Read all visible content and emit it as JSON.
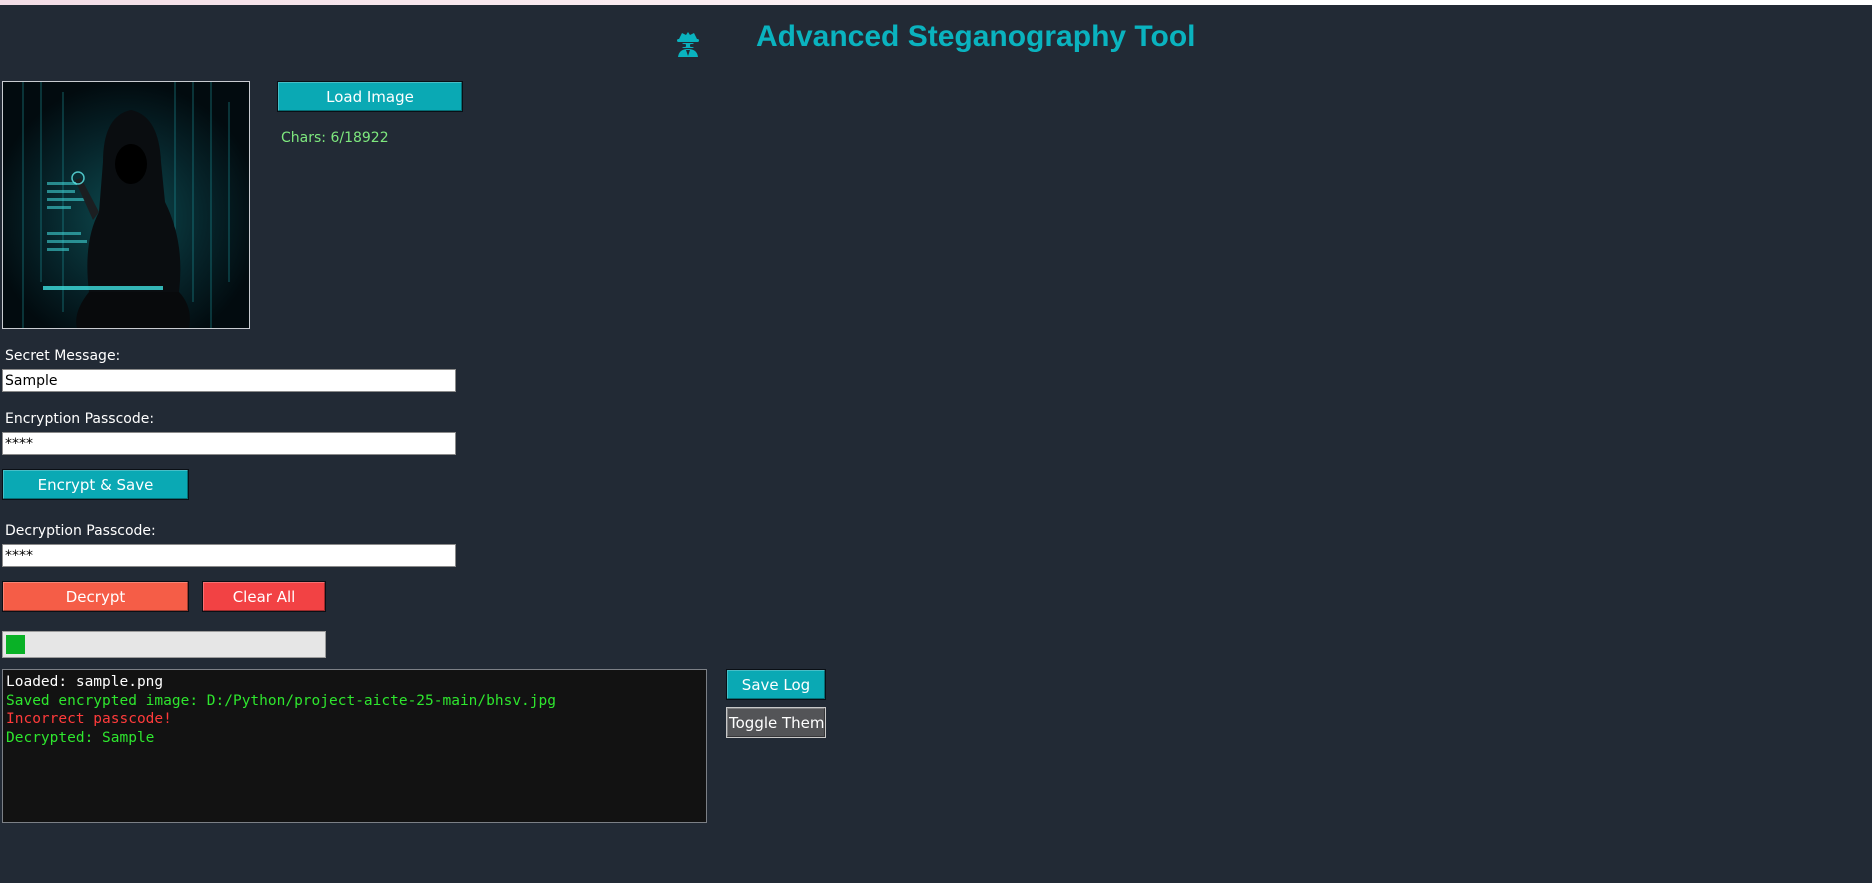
{
  "window": {
    "title": "Advanced Steganography Tool",
    "title_icon": "spy-icon",
    "accent": "#0ab3bf",
    "background": "#222a35"
  },
  "image_panel": {
    "preview_icon": "hooded-hacker-image",
    "load_button": "Load Image",
    "char_count": "Chars: 6/18922"
  },
  "encrypt": {
    "message_label": "Secret Message:",
    "message_value": "Sample",
    "passcode_label": "Encryption Passcode:",
    "passcode_value": "****",
    "button": "Encrypt & Save"
  },
  "decrypt": {
    "passcode_label": "Decryption Passcode:",
    "passcode_value": "****",
    "decrypt_button": "Decrypt",
    "clear_button": "Clear All"
  },
  "progress": {
    "fraction": 0.06,
    "fill_color": "#09b126"
  },
  "log": {
    "lines": [
      {
        "text": "Loaded: sample.png",
        "color": "#ffffff"
      },
      {
        "text": "Saved encrypted image: D:/Python/project-aicte-25-main/bhsv.jpg",
        "color": "#2ee62e"
      },
      {
        "text": "Incorrect passcode!",
        "color": "#ff3b3b"
      },
      {
        "text": "Decrypted: Sample",
        "color": "#2ee62e"
      }
    ],
    "save_button": "Save Log",
    "theme_button": "Toggle Theme"
  }
}
